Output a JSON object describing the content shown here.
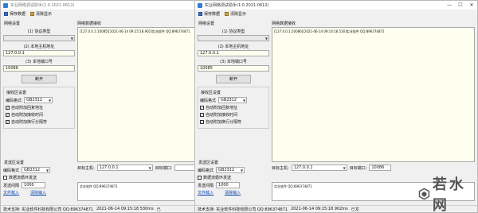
{
  "windows": [
    {
      "title": "实业网络调试助手(1.0.2021.0612)",
      "toolbar": {
        "save": "保存数据",
        "clear": "清除显示"
      },
      "net_settings": {
        "title": "网络设置",
        "protocol_label": "(1) 协议类型",
        "protocol_value": "",
        "host_label": "(2) 本地主机地址",
        "host_value": "127.0.0.1",
        "port_label": "(3) 本地端口号",
        "port_value": "10086",
        "open_button": "断开"
      },
      "recv_settings": {
        "title": "接收区设置",
        "encoding_label": "编码格式",
        "encoding_value": "GB2312",
        "options": [
          {
            "label": "自动附加回复地址",
            "checked": true
          },
          {
            "label": "自动附加接收时间",
            "checked": true
          },
          {
            "label": "自动附加换行分隔符",
            "checked": true
          }
        ]
      },
      "send_settings": {
        "title": "发送区设置",
        "encoding_label": "编码格式",
        "encoding_value": "GB2312",
        "loop_label": "数据流循环发送",
        "loop_checked": false,
        "interval_label": "发送间隔",
        "interval_value": "1000",
        "file_load": "文件载入",
        "clear_input": "清除输入"
      },
      "recv_area": {
        "title": "网络数据接收",
        "content": "[127.0.0.1:10085][2021-06-14 09:15:18.902]实业软件 QQ:896374871"
      },
      "target": {
        "host_label": "目标主机:",
        "host_value": "127.0.0.1",
        "port_label": "目标端口:",
        "port_value": ""
      },
      "send_area": {
        "content": "实业软件 QQ:896374871"
      },
      "status": {
        "support": "技术支持: 实业软件科技有限公司 QQ:896374871",
        "time": "2021-06-14 09:15:18 530ms",
        "tail": "已"
      }
    },
    {
      "title": "实业网络调试助手(1.0.2021.0612)",
      "toolbar": {
        "save": "保存数据",
        "clear": "清除显示"
      },
      "net_settings": {
        "title": "网络设置",
        "protocol_label": "(1) 协议类型",
        "protocol_value": "",
        "host_label": "(2) 本地主机地址",
        "host_value": "127.0.0.1",
        "port_label": "(3) 本地端口号",
        "port_value": "10085",
        "open_button": "断开"
      },
      "recv_settings": {
        "title": "接收区设置",
        "encoding_label": "编码格式",
        "encoding_value": "GB2312",
        "options": [
          {
            "label": "自动附加回复地址",
            "checked": true
          },
          {
            "label": "自动附加接收时间",
            "checked": true
          },
          {
            "label": "自动附加换行分隔符",
            "checked": true
          }
        ]
      },
      "send_settings": {
        "title": "发送区设置",
        "encoding_label": "编码格式",
        "encoding_value": "GB2312",
        "loop_label": "数据流循环发送",
        "loop_checked": false,
        "interval_label": "发送间隔",
        "interval_value": "1000",
        "file_load": "文件载入",
        "clear_input": "清除输入"
      },
      "recv_area": {
        "title": "网络数据接收",
        "content": "[127.0.0.1:10086][2021-06-14 09:14:18.530]实业软件 QQ:896374871"
      },
      "target": {
        "host_label": "目标主机:",
        "host_value": "127.0.0.1",
        "port_label": "目标端口:",
        "port_value": "10086"
      },
      "send_area": {
        "content": "实业软件 QQ:896374871"
      },
      "status": {
        "support": "技术支持: 实业软件科技有限公司 QQ:896374871",
        "time": "2021-06-14 09:15:18 902ms",
        "tail": "已发"
      }
    }
  ],
  "watermark": {
    "text": "若水网",
    "icon": "hexagon-logo-icon"
  },
  "colors": {
    "input_bg": "#fffff0",
    "accent": "#2f7fd6",
    "link": "#0645ad"
  }
}
